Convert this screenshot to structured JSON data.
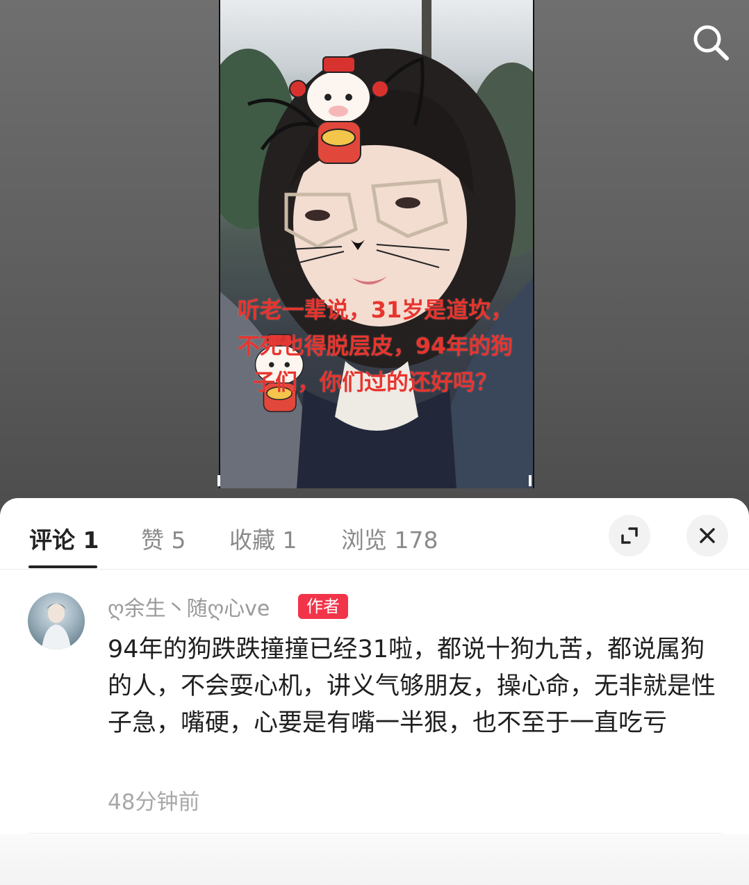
{
  "post": {
    "overlay_text": "听老一辈说，31岁是道坎，不死也得脱层皮，94年的狗子们，你们过的还好吗？"
  },
  "top_bar": {
    "search_icon": "search-icon"
  },
  "tabs": [
    {
      "label": "评论 1",
      "active": true
    },
    {
      "label": "赞 5",
      "active": false
    },
    {
      "label": "收藏 1",
      "active": false
    },
    {
      "label": "浏览 178",
      "active": false
    }
  ],
  "actions": {
    "expand_icon": "expand-icon",
    "close_icon": "close-icon"
  },
  "comment": {
    "username": "ღ余生丶随ღ心ve",
    "badge": "作者",
    "text": "94年的狗跌跌撞撞已经31啦，都说十狗九苦，都说属狗的人，不会耍心机，讲义气够朋友，操心命，无非就是性子急，嘴硬，心要是有嘴一半狠，也不至于一直吃亏",
    "time": "48分钟前"
  },
  "colors": {
    "accent_red": "#f2344a",
    "overlay_red": "#e8342e"
  }
}
